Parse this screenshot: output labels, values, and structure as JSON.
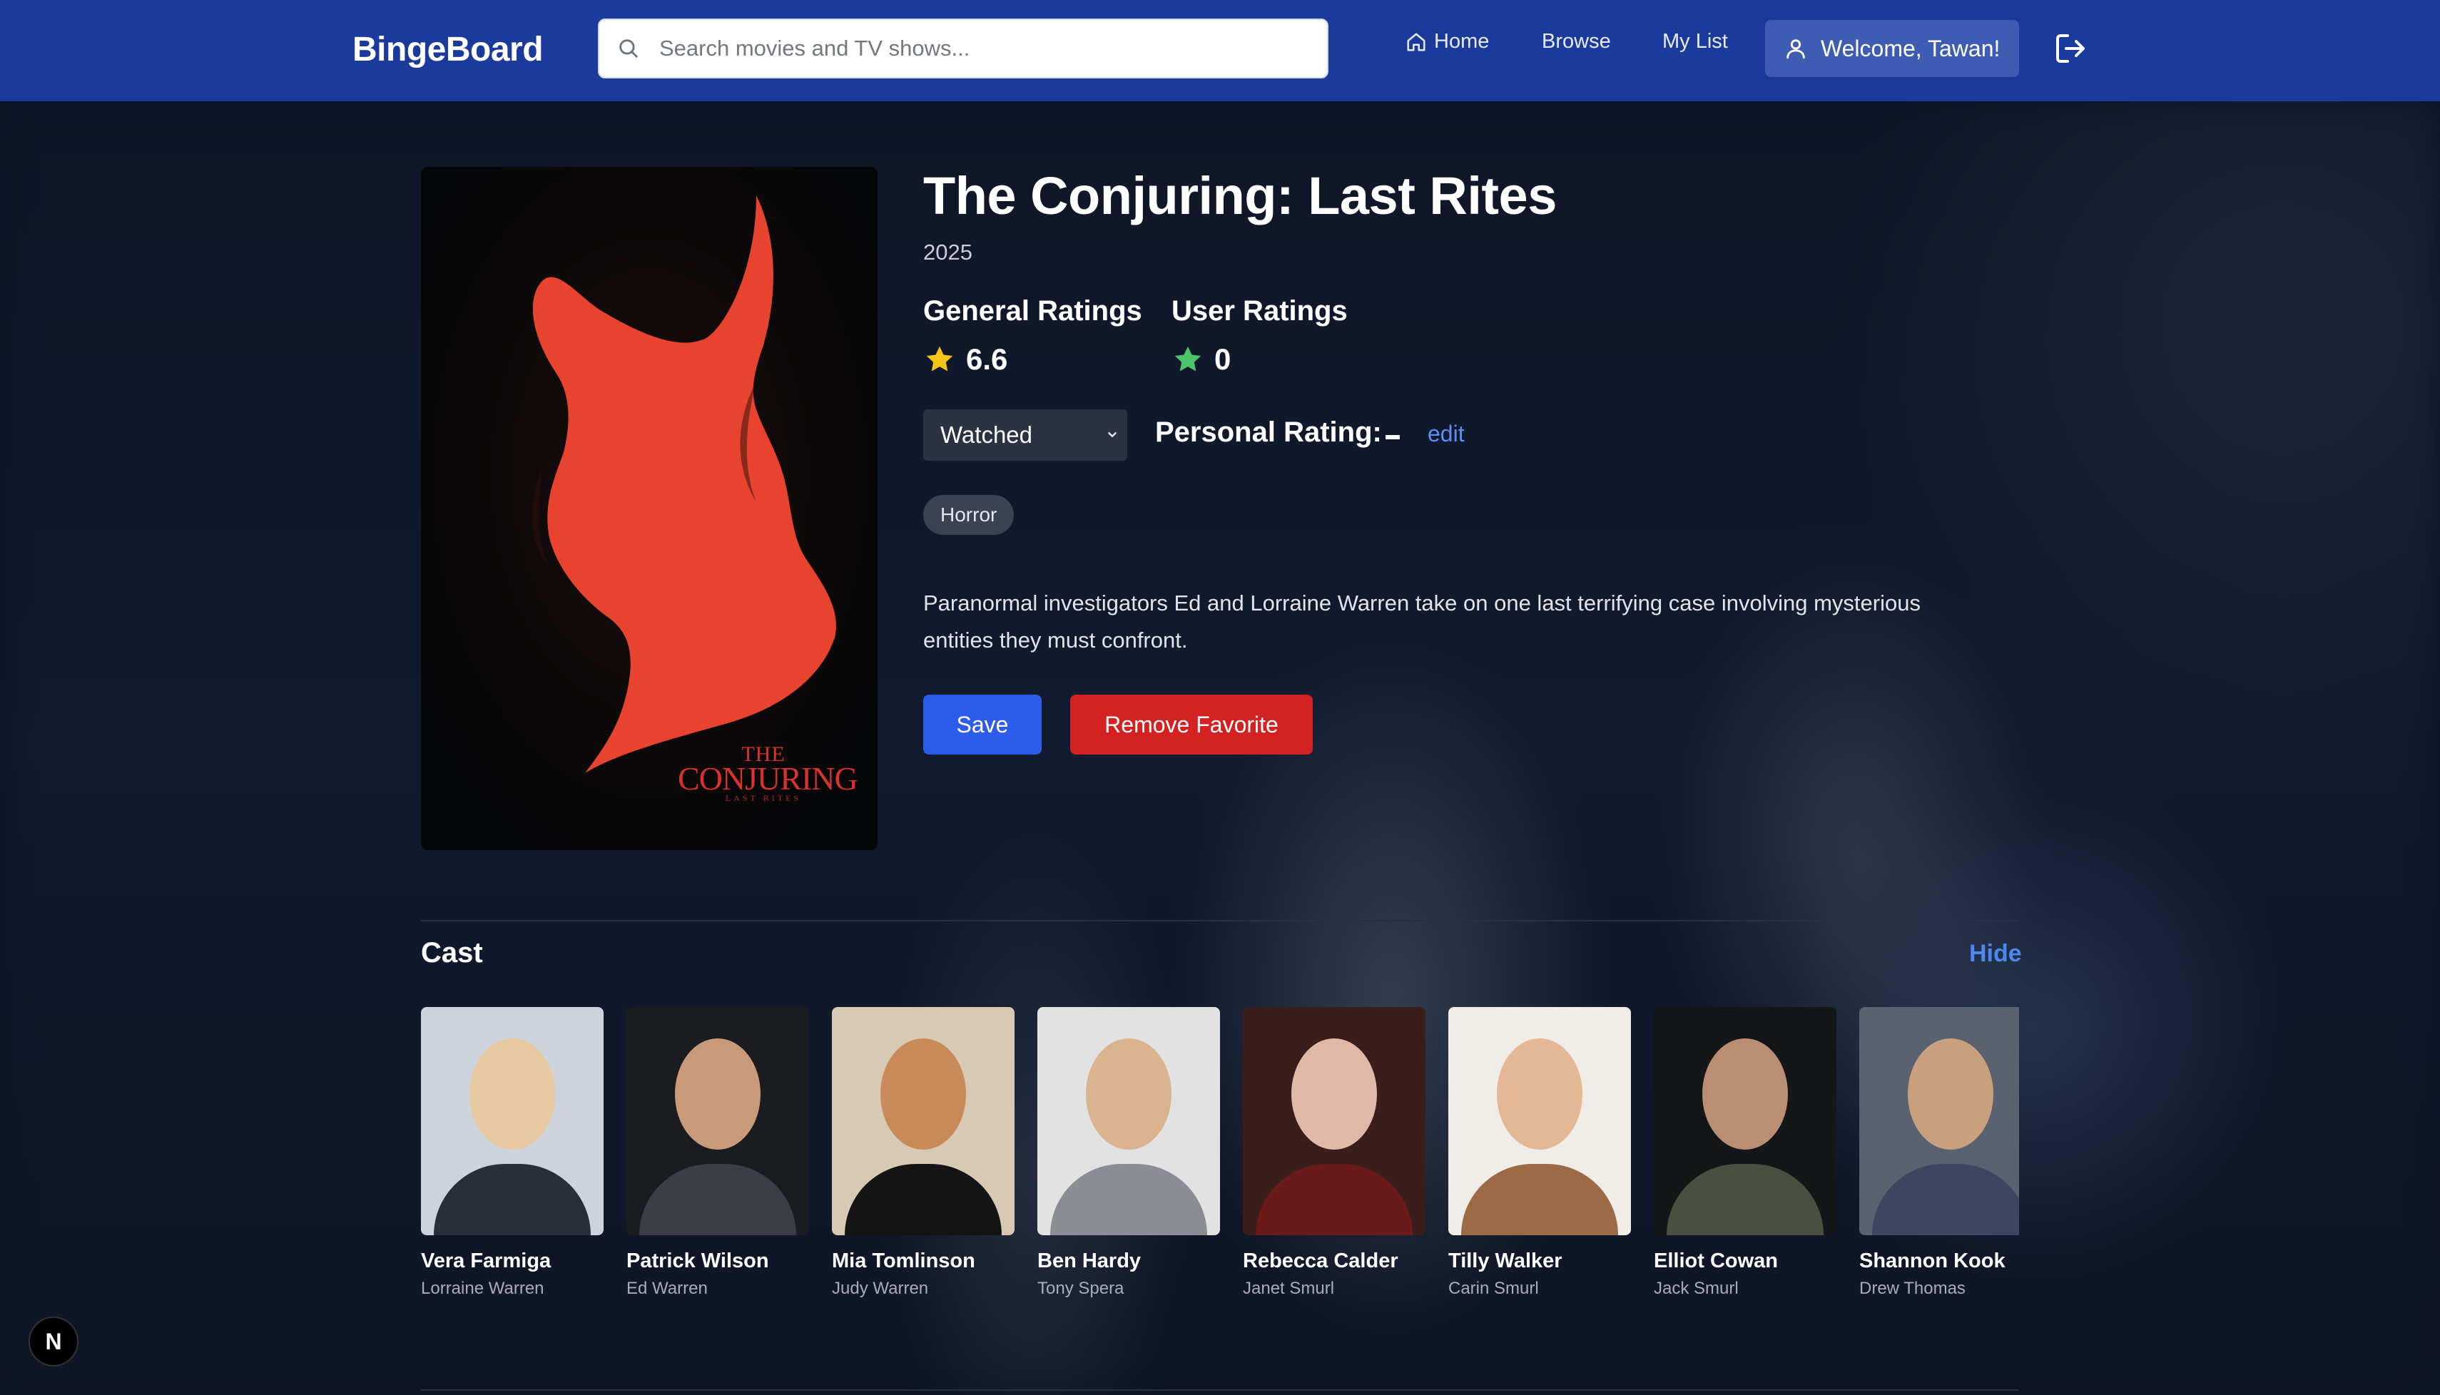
{
  "app": {
    "brand": "BingeBoard"
  },
  "search": {
    "placeholder": "Search movies and TV shows..."
  },
  "nav": {
    "home": "Home",
    "browse": "Browse",
    "my_list": "My List",
    "welcome": "Welcome, Tawan!"
  },
  "movie": {
    "title": "The Conjuring: Last Rites",
    "year": "2025",
    "general_ratings_label": "General Ratings",
    "general_rating": "6.6",
    "user_ratings_label": "User Ratings",
    "user_rating": "0",
    "status": "Watched",
    "personal_rating_label": "Personal Rating:",
    "personal_rating_edit": "edit",
    "genres": [
      "Horror"
    ],
    "synopsis": "Paranormal investigators Ed and Lorraine Warren take on one last terrifying case involving mysterious entities they must confront.",
    "save_label": "Save",
    "remove_favorite_label": "Remove Favorite",
    "poster": {
      "line1": "THE",
      "line2": "CONJURING",
      "line3": "LAST RITES"
    }
  },
  "cast": {
    "title": "Cast",
    "hide_label": "Hide",
    "members": [
      {
        "name": "Vera Farmiga",
        "role": "Lorraine Warren"
      },
      {
        "name": "Patrick Wilson",
        "role": "Ed Warren"
      },
      {
        "name": "Mia Tomlinson",
        "role": "Judy Warren"
      },
      {
        "name": "Ben Hardy",
        "role": "Tony Spera"
      },
      {
        "name": "Rebecca Calder",
        "role": "Janet Smurl"
      },
      {
        "name": "Tilly Walker",
        "role": "Carin Smurl"
      },
      {
        "name": "Elliot Cowan",
        "role": "Jack Smurl"
      },
      {
        "name": "Shannon Kook",
        "role": "Drew Thomas"
      }
    ]
  },
  "dev_badge": "N",
  "colors": {
    "header": "#1a3a9c",
    "accent_blue": "#2d5bea",
    "danger_red": "#d42121",
    "star_yellow": "#f5c518",
    "star_green": "#4cc46a",
    "link_blue": "#5b8ff0"
  }
}
